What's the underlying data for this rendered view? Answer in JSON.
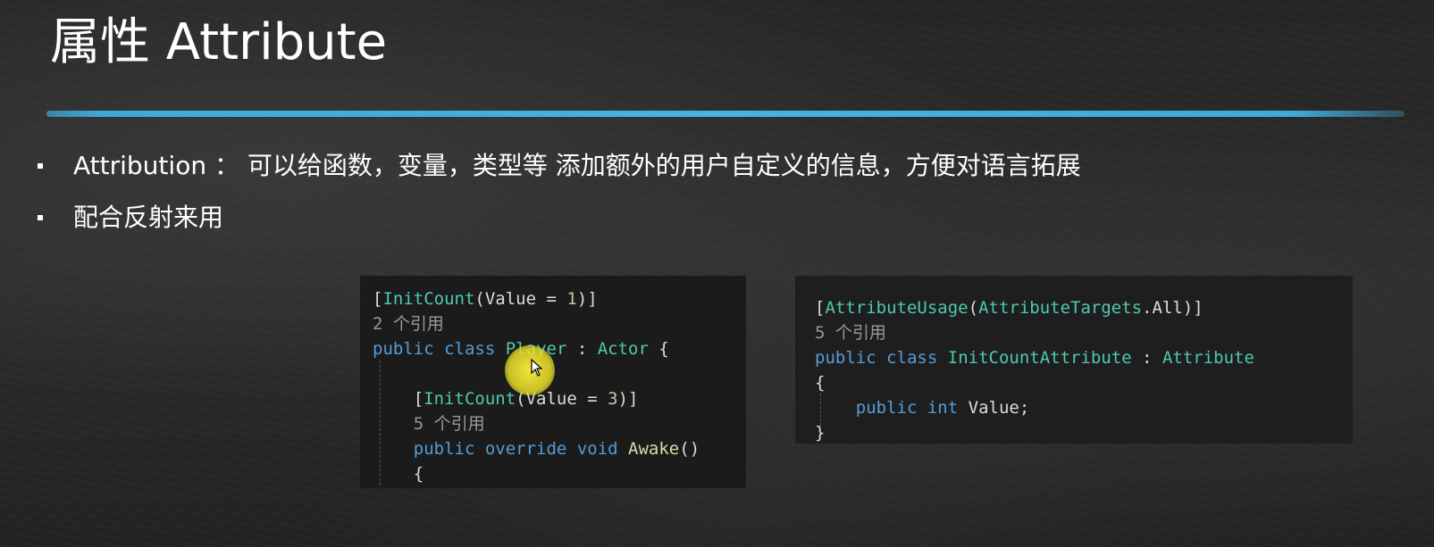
{
  "slide": {
    "title": "属性 Attribute"
  },
  "bullets": [
    {
      "text": "Attribution ： 可以给函数，变量，类型等 添加额外的用户自定义的信息，方便对语言拓展"
    },
    {
      "text": "配合反射来用"
    }
  ],
  "code_left": {
    "lines": [
      {
        "tokens": [
          {
            "t": "[",
            "c": "plain"
          },
          {
            "t": "InitCount",
            "c": "type"
          },
          {
            "t": "(Value = ",
            "c": "plain"
          },
          {
            "t": "1",
            "c": "num"
          },
          {
            "t": ")]",
            "c": "plain"
          }
        ]
      },
      {
        "tokens": [
          {
            "t": "2 个引用",
            "c": "ref"
          }
        ]
      },
      {
        "tokens": [
          {
            "t": "public",
            "c": "kw"
          },
          {
            "t": " ",
            "c": "plain"
          },
          {
            "t": "class",
            "c": "kw"
          },
          {
            "t": " ",
            "c": "plain"
          },
          {
            "t": "Player",
            "c": "type"
          },
          {
            "t": " : ",
            "c": "plain"
          },
          {
            "t": "Actor",
            "c": "type"
          },
          {
            "t": " {",
            "c": "plain"
          }
        ]
      },
      {
        "tokens": [
          {
            "t": "",
            "c": "plain"
          }
        ]
      },
      {
        "tokens": [
          {
            "t": "    [",
            "c": "plain"
          },
          {
            "t": "InitCount",
            "c": "type"
          },
          {
            "t": "(Value = ",
            "c": "plain"
          },
          {
            "t": "3",
            "c": "num"
          },
          {
            "t": ")]",
            "c": "plain"
          }
        ]
      },
      {
        "tokens": [
          {
            "t": "    5 个引用",
            "c": "ref"
          }
        ]
      },
      {
        "tokens": [
          {
            "t": "    ",
            "c": "plain"
          },
          {
            "t": "public",
            "c": "kw"
          },
          {
            "t": " ",
            "c": "plain"
          },
          {
            "t": "override",
            "c": "kw"
          },
          {
            "t": " ",
            "c": "plain"
          },
          {
            "t": "void",
            "c": "kw"
          },
          {
            "t": " ",
            "c": "plain"
          },
          {
            "t": "Awake",
            "c": "fn"
          },
          {
            "t": "()",
            "c": "plain"
          }
        ]
      },
      {
        "tokens": [
          {
            "t": "    {",
            "c": "plain"
          }
        ]
      }
    ]
  },
  "code_right": {
    "lines": [
      {
        "tokens": [
          {
            "t": "[",
            "c": "plain"
          },
          {
            "t": "AttributeUsage",
            "c": "type"
          },
          {
            "t": "(",
            "c": "plain"
          },
          {
            "t": "AttributeTargets",
            "c": "type"
          },
          {
            "t": ".All)]",
            "c": "plain"
          }
        ]
      },
      {
        "tokens": [
          {
            "t": "5 个引用",
            "c": "ref"
          }
        ]
      },
      {
        "tokens": [
          {
            "t": "public",
            "c": "kw"
          },
          {
            "t": " ",
            "c": "plain"
          },
          {
            "t": "class",
            "c": "kw"
          },
          {
            "t": " ",
            "c": "plain"
          },
          {
            "t": "InitCountAttribute",
            "c": "type"
          },
          {
            "t": " : ",
            "c": "plain"
          },
          {
            "t": "Attribute",
            "c": "type"
          }
        ]
      },
      {
        "tokens": [
          {
            "t": "{",
            "c": "plain"
          }
        ]
      },
      {
        "tokens": [
          {
            "t": "    ",
            "c": "plain"
          },
          {
            "t": "public",
            "c": "kw"
          },
          {
            "t": " ",
            "c": "plain"
          },
          {
            "t": "int",
            "c": "kw"
          },
          {
            "t": " Value;",
            "c": "plain"
          }
        ]
      },
      {
        "tokens": [
          {
            "t": "}",
            "c": "plain"
          }
        ]
      }
    ]
  },
  "colors": {
    "accent_rule": "#3fa9d8",
    "keyword": "#569cd6",
    "type": "#4ec9b0",
    "function": "#dcdcaa",
    "number": "#b5cea8",
    "reference_hint": "#999999",
    "cursor_highlight": "#f5e63a"
  },
  "cursor": {
    "icon": "mouse-pointer-icon"
  }
}
